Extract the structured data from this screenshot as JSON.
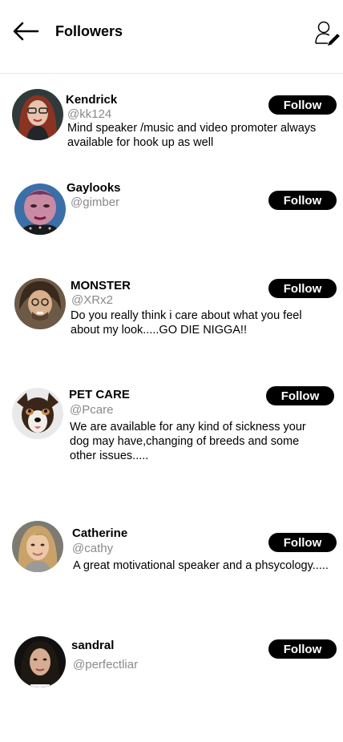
{
  "header": {
    "title": "Followers"
  },
  "followers": [
    {
      "name": "Kendrick",
      "handle": "@kk124",
      "bio": "Mind speaker /music and video promoter always available for hook up as well",
      "follow_label": "Follow"
    },
    {
      "name": "Gaylooks",
      "handle": "@gimber",
      "bio": "",
      "follow_label": "Follow"
    },
    {
      "name": "MONSTER",
      "handle": "@XRx2",
      "bio": "Do you really think i care about what you feel about my look.....GO DIE NIGGA!!",
      "follow_label": "Follow"
    },
    {
      "name": "PET CARE",
      "handle": "@Pcare",
      "bio": "We are available for any kind of sickness your dog may have,changing of breeds and some other issues.....",
      "follow_label": "Follow"
    },
    {
      "name": "Catherine",
      "handle": "@cathy",
      "bio": "A great motivational speaker and a phsycology.....",
      "follow_label": "Follow"
    },
    {
      "name": "sandral",
      "handle": "@perfectliar",
      "bio": "",
      "follow_label": "Follow"
    }
  ],
  "colors": {
    "button_bg": "#000000",
    "handle_gray": "#8a8a8a",
    "divider": "#e6e6e6"
  }
}
